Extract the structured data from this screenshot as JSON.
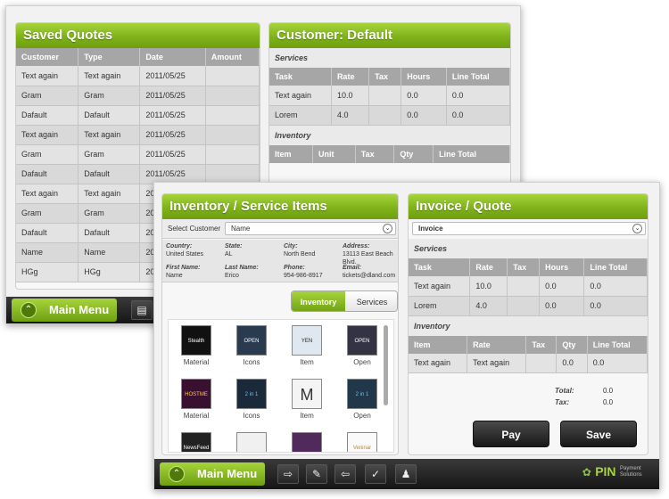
{
  "back": {
    "saved_quotes": {
      "title": "Saved Quotes",
      "columns": [
        "Customer",
        "Type",
        "Date",
        "Amount"
      ],
      "rows": [
        [
          "Text again",
          "Text again",
          "2011/05/25",
          ""
        ],
        [
          "Gram",
          "Gram",
          "2011/05/25",
          ""
        ],
        [
          "Dafault",
          "Dafault",
          "2011/05/25",
          ""
        ],
        [
          "Text again",
          "Text again",
          "2011/05/25",
          ""
        ],
        [
          "Gram",
          "Gram",
          "2011/05/25",
          ""
        ],
        [
          "Dafault",
          "Dafault",
          "2011/05/25",
          ""
        ],
        [
          "Text again",
          "Text again",
          "2011/05/25",
          ""
        ],
        [
          "Gram",
          "Gram",
          "2011/05/25",
          ""
        ],
        [
          "Dafault",
          "Dafault",
          "2011/05/25",
          ""
        ],
        [
          "Name",
          "Name",
          "2011/05/25",
          ""
        ],
        [
          "HGg",
          "HGg",
          "2011/05/25",
          ""
        ]
      ]
    },
    "customer": {
      "title": "Customer: Default",
      "services_label": "Services",
      "services_columns": [
        "Task",
        "Rate",
        "Tax",
        "Hours",
        "Line Total"
      ],
      "services_rows": [
        [
          "Text again",
          "10.0",
          "",
          "0.0",
          "0.0"
        ],
        [
          "Lorem",
          "4.0",
          "",
          "0.0",
          "0.0"
        ]
      ],
      "inventory_label": "Inventory",
      "inventory_columns": [
        "Item",
        "Unit",
        "Tax",
        "Qty",
        "Line Total"
      ]
    },
    "main_menu": "Main Menu"
  },
  "front": {
    "inventory": {
      "title": "Inventory / Service Items",
      "select_label": "Select Customer",
      "select_value": "Name",
      "info": [
        {
          "label": "Country:",
          "value": "United States"
        },
        {
          "label": "State:",
          "value": "AL"
        },
        {
          "label": "City:",
          "value": "North Bend"
        },
        {
          "label": "Address:",
          "value": "13113 East Beach Blvd."
        },
        {
          "label": "First Name:",
          "value": "Name"
        },
        {
          "label": "Last Name:",
          "value": "Erico"
        },
        {
          "label": "Phone:",
          "value": "954-986-8917"
        },
        {
          "label": "Email:",
          "value": "tickets@dland.com"
        }
      ],
      "tab_inventory": "Inventory",
      "tab_services": "Services",
      "tiles": [
        {
          "label": "Material",
          "thumb": "Stealth"
        },
        {
          "label": "Icons",
          "thumb": "OPEN"
        },
        {
          "label": "Item",
          "thumb": "YEN"
        },
        {
          "label": "Open",
          "thumb": "OPEN"
        },
        {
          "label": "Material",
          "thumb": "HOSTME"
        },
        {
          "label": "Icons",
          "thumb": "2 in 1"
        },
        {
          "label": "Item",
          "thumb": "M"
        },
        {
          "label": "Open",
          "thumb": "2 in 1"
        },
        {
          "label": "",
          "thumb": "NewsFeed"
        },
        {
          "label": "",
          "thumb": ""
        },
        {
          "label": "",
          "thumb": ""
        },
        {
          "label": "",
          "thumb": "Veninar"
        }
      ]
    },
    "invoice": {
      "title": "Invoice / Quote",
      "select_value": "Invoice",
      "services_label": "Services",
      "services_columns": [
        "Task",
        "Rate",
        "Tax",
        "Hours",
        "Line Total"
      ],
      "services_rows": [
        [
          "Text again",
          "10.0",
          "",
          "0.0",
          "0.0"
        ],
        [
          "Lorem",
          "4.0",
          "",
          "0.0",
          "0.0"
        ]
      ],
      "inventory_label": "Inventory",
      "inventory_columns": [
        "Item",
        "Rate",
        "Tax",
        "Qty",
        "Line Total"
      ],
      "inventory_rows": [
        [
          "Text again",
          "Text again",
          "",
          "0.0",
          "0.0"
        ]
      ],
      "total_label": "Total:",
      "total_value": "0.0",
      "tax_label": "Tax:",
      "tax_value": "0.0",
      "pay_label": "Pay",
      "save_label": "Save"
    },
    "main_menu": "Main Menu",
    "logo": "PIN",
    "logo_sub": "Payment Solutions"
  },
  "colors": {
    "accent": "#7fb219",
    "bar": "#1e1e1e"
  }
}
